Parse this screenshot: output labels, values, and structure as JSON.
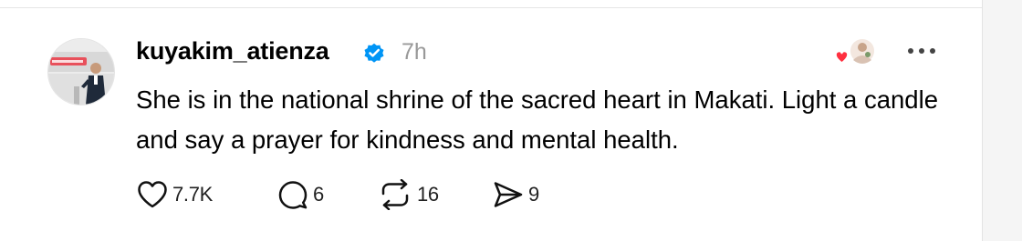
{
  "post": {
    "username": "kuyakim_atienza",
    "timestamp": "7h",
    "text": "She is in the national shrine of the sacred heart in Makati. Light a candle and say a prayer for kindness and mental health.",
    "avatar_icon": "profile-photo",
    "verified_icon": "verified-badge-icon",
    "tagged_avatars_icon": "tagged-users-icon"
  },
  "actions": {
    "likes": "7.7K",
    "comments": "6",
    "reposts": "16",
    "shares": "9"
  },
  "colors": {
    "verified": "#0095f6",
    "timestamp": "#999999",
    "heart": "#ff3040",
    "text": "#000000"
  }
}
